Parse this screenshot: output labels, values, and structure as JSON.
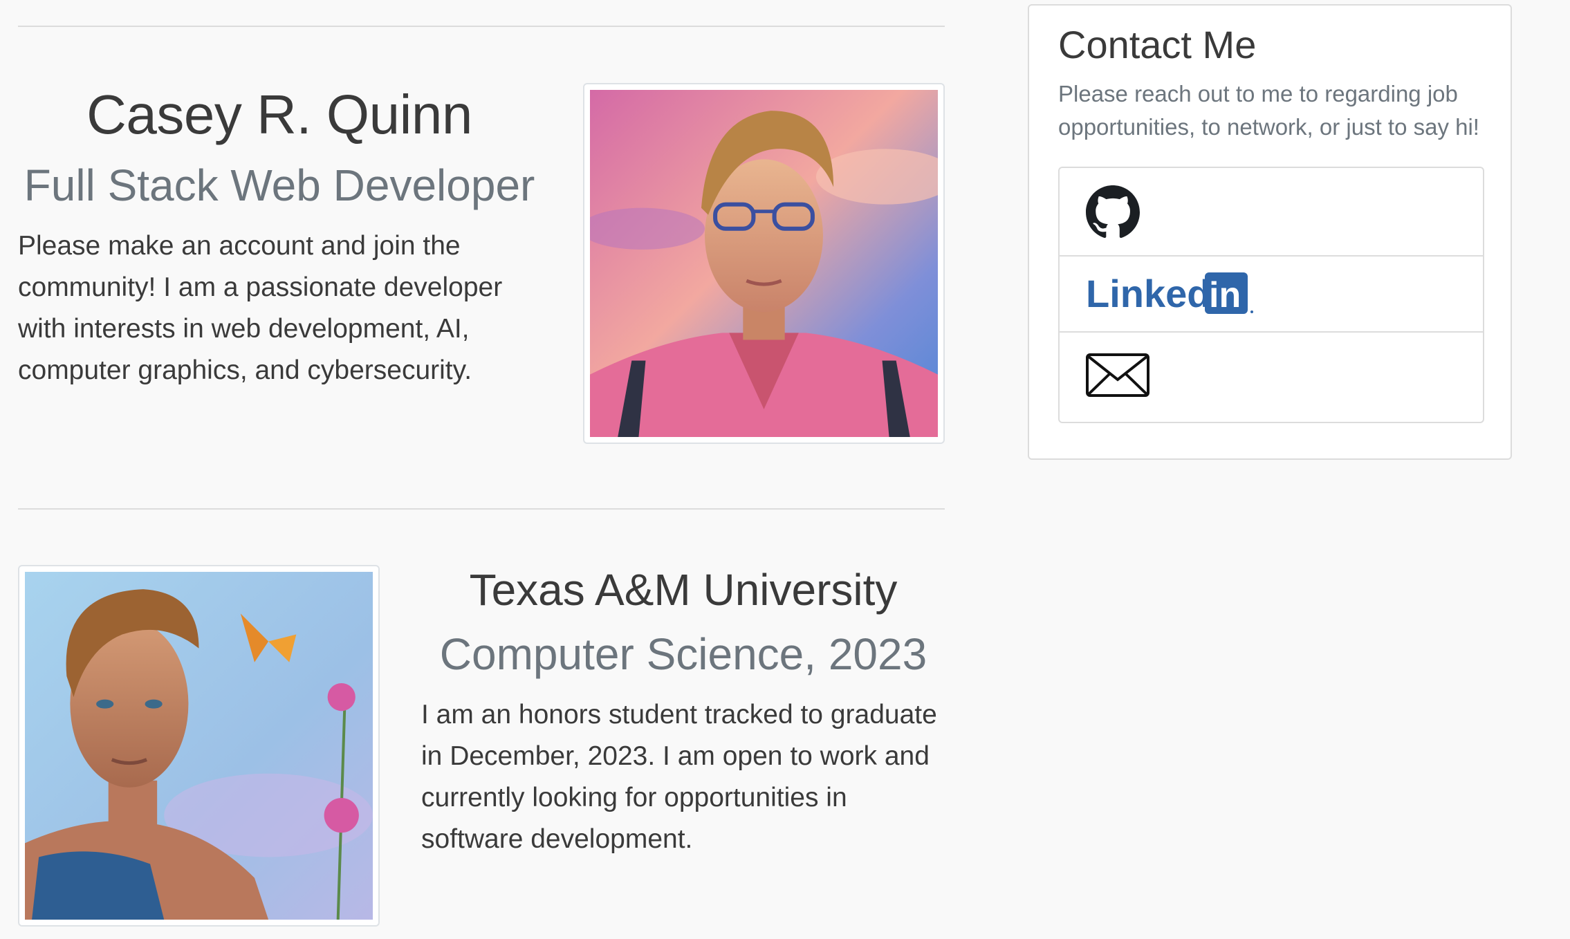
{
  "hero": {
    "name": "Casey R. Quinn",
    "role": "Full Stack Web Developer",
    "description": "Please make an account and join the community! I am a passionate developer with interests in web development, AI, computer graphics, and cybersecurity."
  },
  "education": {
    "school": "Texas A&M University",
    "major": "Computer Science, 2023",
    "description": "I am an honors student tracked to graduate in December, 2023. I am open to work and currently looking for opportunities in software development."
  },
  "contact": {
    "title": "Contact Me",
    "description": "Please reach out to me to regarding job opportunities, to network, or just to say hi!",
    "links": [
      {
        "icon": "github-icon"
      },
      {
        "icon": "linkedin-logo",
        "text_part": "Linked",
        "box_part": "in"
      },
      {
        "icon": "mail-icon"
      }
    ]
  },
  "colors": {
    "background": "#f9f9f9",
    "heading": "#3a3a3a",
    "muted": "#6c757d",
    "linkedin": "#0a66c2"
  }
}
